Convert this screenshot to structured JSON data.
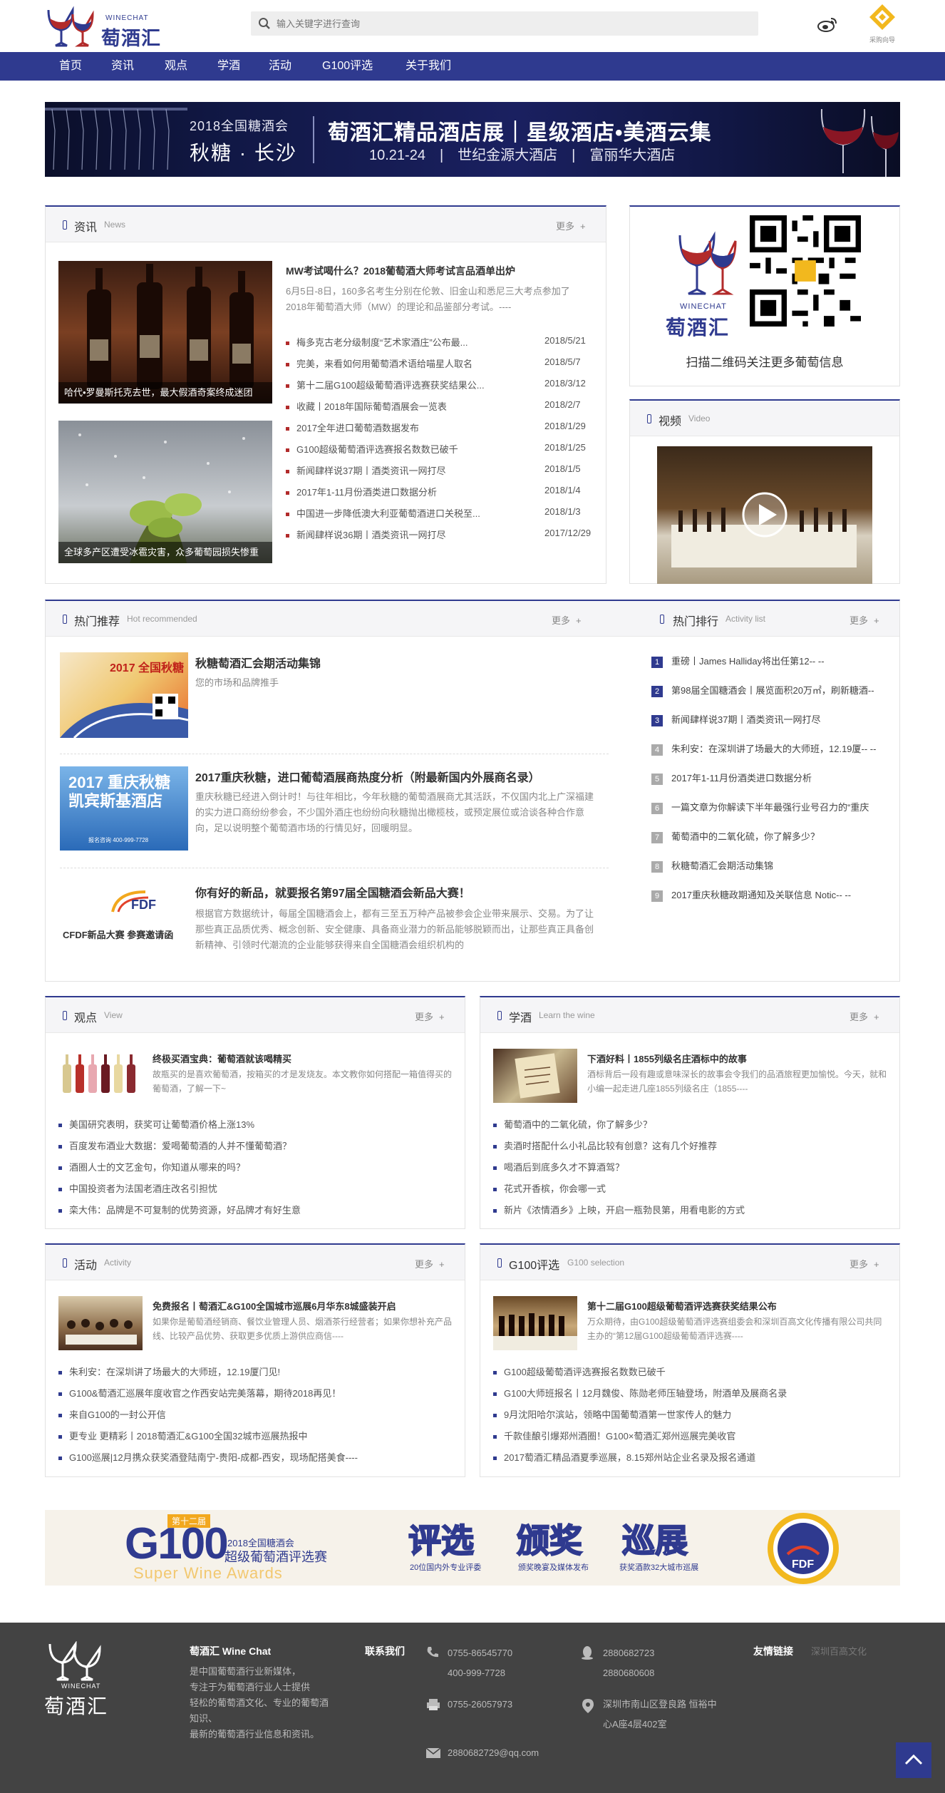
{
  "header": {
    "logo_en": "WINECHAT",
    "logo_cn": "萄酒汇",
    "search_placeholder": "输入关键字进行查询",
    "wechat_label": "采购向导"
  },
  "nav": {
    "items": [
      "首页",
      "资讯",
      "观点",
      "学酒",
      "活动",
      "G100评选",
      "关于我们"
    ]
  },
  "banner": {
    "left_line1": "2018全国糖酒会",
    "left_line2": "秋糖 · 长沙",
    "title": "萄酒汇精品酒店展｜星级酒店•美酒云集",
    "subtitle": "10.21-24　|　世纪金源大酒店　|　富丽华大酒店"
  },
  "news": {
    "title": "资讯",
    "sub": "News",
    "more": "更多",
    "plus": "+",
    "img1_caption": "哈代•罗曼斯托克去世，最大假酒奇案终成迷团",
    "img2_caption": "全球多产区遭受冰雹灾害，众多葡萄园损失惨重",
    "lead_title": "MW考试喝什么？2018葡萄酒大师考试言品酒单出炉",
    "lead_desc": "6月5日-8日，160多名考生分别在伦敦、旧金山和悉尼三大考点参加了2018年葡萄酒大师（MW）的理论和品鉴部分考试。----",
    "items": [
      {
        "title": "梅多克古老分级制度“艺术家酒庄”公布最...",
        "date": "2018/5/21"
      },
      {
        "title": "完美，来看如何用葡萄酒术语给喵星人取名",
        "date": "2018/5/7"
      },
      {
        "title": "第十二届G100超级葡萄酒评选赛获奖结果公...",
        "date": "2018/3/12"
      },
      {
        "title": "收藏丨2018年国际葡萄酒展会一览表",
        "date": "2018/2/7"
      },
      {
        "title": "2017全年进口葡萄酒数据发布",
        "date": "2018/1/29"
      },
      {
        "title": "G100超级葡萄酒评选赛报名数数已破千",
        "date": "2018/1/25"
      },
      {
        "title": "新闻肆样说37期丨酒类资讯一网打尽",
        "date": "2018/1/5"
      },
      {
        "title": "2017年1-11月份酒类进口数据分析",
        "date": "2018/1/4"
      },
      {
        "title": "中国进一步降低澳大利亚葡萄酒进口关税至...",
        "date": "2018/1/3"
      },
      {
        "title": "新闻肆样说36期丨酒类资讯一网打尽",
        "date": "2017/12/29"
      }
    ]
  },
  "qr": {
    "logo_en": "WINECHAT",
    "logo_cn": "萄酒汇",
    "caption": "扫描二维码关注更多葡萄信息"
  },
  "video": {
    "title": "视频",
    "sub": "Video"
  },
  "hot": {
    "title": "热门推荐",
    "sub": "Hot recommended",
    "more": "更多",
    "plus": "+",
    "items": [
      {
        "title": "秋糖萄酒汇会期活动集锦",
        "desc": "您的市场和品牌推手",
        "img_text": "2017 全国秋糖"
      },
      {
        "title": "2017重庆秋糖，进口葡萄酒展商热度分析（附最新国内外展商名录）",
        "desc": "重庆秋糖已经进入倒计时！与往年相比，今年秋糖的葡萄酒展商尤其活跃，不仅国内北上广深福建的实力进口商纷纷参会，不少国外酒庄也纷纷向秋糖抛出橄榄枝，或预定展位或洽谈各种合作意向，足以说明整个葡萄酒市场的行情见好，回暖明显。",
        "img_text": "2017 重庆秋糖 凯宾斯基酒店",
        "img_phone": "报名咨询 400-999-7728"
      },
      {
        "title": "你有好的新品，就要报名第97届全国糖酒会新品大赛！",
        "desc": "根据官方数据统计，每届全国糖酒会上，都有三至五万种产品被参会企业带来展示、交易。为了让那些真正品质优秀、概念创新、安全健康、具备商业潜力的新品能够脱颖而出，让那些真正具备创新精神、引领时代潮流的企业能够获得来自全国糖酒会组织机构的",
        "img_text": "CFDF新品大赛 参赛邀请函",
        "img_logo": "FDF"
      }
    ]
  },
  "ranking": {
    "title": "热门排行",
    "sub": "Activity list",
    "more": "更多",
    "plus": "+",
    "items": [
      "重磅丨James Halliday将出任第12-- --",
      "第98届全国糖酒会丨展览面积20万㎡，刷新糖酒--",
      "新闻肆样说37期丨酒类资讯一网打尽",
      "朱利安：在深圳讲了场最大的大师班，12.19厦-- --",
      "2017年1-11月份酒类进口数据分析",
      "一篇文章为你解读下半年最强行业号召力的“重庆",
      "葡萄酒中的二氧化硫，你了解多少？",
      "秋糖萄酒汇会期活动集锦",
      "2017重庆秋糖政期通知及关联信息 Notic-- --"
    ]
  },
  "view": {
    "title": "观点",
    "sub": "View",
    "more": "更多",
    "plus": "+",
    "lead_title": "终极买酒宝典：葡萄酒就该喝精买",
    "lead_desc": "故瓶买的是喜欢葡萄酒，按箱买的才是发烧友。本文教你如何搭配一箱值得买的葡萄酒，了解一下~",
    "items": [
      "美国研究表明，获奖可让葡萄酒价格上涨13%",
      "百度发布酒业大数据：爱喝葡萄酒的人并不懂葡萄酒？",
      "酒圈人士的文艺金句，你知道从哪来的吗？",
      "中国投资者为法国老酒庄改名引担忧",
      "栾大伟：品牌是不可复制的优势资源，好品牌才有好生意"
    ]
  },
  "learn": {
    "title": "学酒",
    "sub": "Learn the wine",
    "more": "更多",
    "plus": "+",
    "lead_title": "下酒好料丨1855列级名庄酒标中的故事",
    "lead_desc": "酒标背后一段有趣或意味深长的故事会令我们的品酒旅程更加愉悦。今天，就和小编一起走进几座1855列级名庄（1855----",
    "items": [
      "葡萄酒中的二氧化硫，你了解多少？",
      "卖酒时搭配什么小礼品比较有创意？这有几个好推荐",
      "喝酒后到底多久才不算酒驾？",
      "花式开香槟，你会哪一式",
      "新片《浓情酒乡》上映，开启一瓶勃艮第，用看电影的方式"
    ]
  },
  "activity": {
    "title": "活动",
    "sub": "Activity",
    "more": "更多",
    "plus": "+",
    "lead_title": "免费报名丨萄酒汇&G100全国城市巡展6月华东8城盛装开启",
    "lead_desc": "如果你是葡萄酒经销商、餐饮业管理人员、烟酒茶行经营者；如果你想补充产品线、比较产品优势、获取更多优质上游供应商信----",
    "items": [
      "朱利安：在深圳讲了场最大的大师班，12.19厦门见!",
      "G100&萄酒汇巡展年度收官之作西安站完美落幕，期待2018再见！",
      "来自G100的一封公开信",
      "更专业 更精彩丨2018萄酒汇&G100全国32城市巡展热报中",
      "G100巡展|12月携众获奖酒登陆南宁-贵阳-成都-西安，现场配搭美食----"
    ]
  },
  "g100": {
    "title": "G100评选",
    "sub": "G100 selection",
    "more": "更多",
    "plus": "+",
    "lead_title": "第十二届G100超级葡萄酒评选赛获奖结果公布",
    "lead_desc": "万众期待，由G100超级葡萄酒评选赛组委会和深圳百高文化传播有限公司共同主办的“第12届G100超级葡萄酒评选赛----",
    "items": [
      "G100超级葡萄酒评选赛报名数数已破千",
      "G100大师班报名丨12月魏俊、陈勋老师压轴登场，附酒单及展商名录",
      "9月沈阳哈尔滨站，领略中国葡萄酒第一世家传人的魅力",
      "千款佳酿引爆郑州酒圈！G100×萄酒汇郑州巡展完美收官",
      "2017萄酒汇精品酒夏季巡展，8.15郑州站企业名录及报名通道"
    ]
  },
  "g100_banner": {
    "edition": "第十二届",
    "big": "G100",
    "line1": "2018全国糖酒会",
    "line2": "超级葡萄酒评选赛",
    "en": "Super Wine Awards",
    "w1": "评选",
    "w1s": "20位国内外专业评委",
    "w2": "颁奖",
    "w2s": "颁奖晚宴及媒体发布",
    "w3": "巡展",
    "w3s": "获奖酒款32大城市巡展",
    "seal": "FDF"
  },
  "footer": {
    "logo_en": "WINECHAT",
    "logo_cn": "萄酒汇",
    "brand_title": "萄酒汇 Wine Chat",
    "brand_desc": [
      "是中国葡萄酒行业新媒体，",
      "专注于为葡萄酒行业人士提供",
      "轻松的葡萄酒文化、专业的葡萄酒",
      "知识、",
      "最新的葡萄酒行业信息和资讯。"
    ],
    "contact_title": "联系我们",
    "phone1": "0755-86545770",
    "phone2": "400-999-7728",
    "fax": "0755-26057973",
    "email": "2880682729@qq.com",
    "qq1": "2880682723",
    "qq2": "2880680608",
    "addr1": "深圳市南山区登良路 恒裕中",
    "addr2": "心A座4层402室",
    "links_title": "友情链接",
    "link1": "深圳百高文化"
  },
  "colors": {
    "brand": "#2f3a8f",
    "footer": "#434343",
    "accent_red": "#b22b2b"
  }
}
